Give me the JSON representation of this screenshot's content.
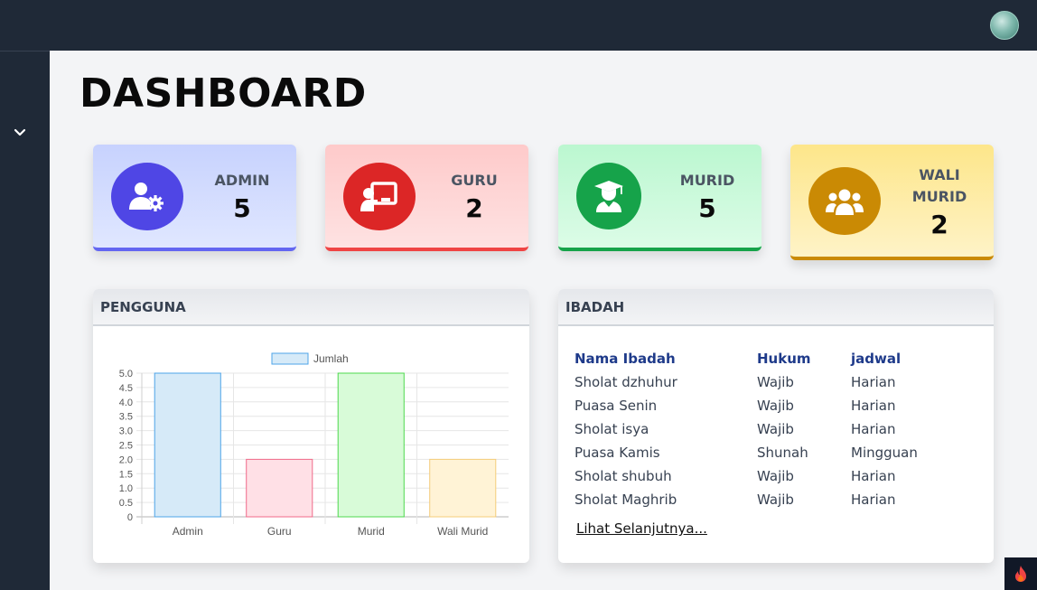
{
  "header": {
    "avatar_icon": "user-avatar"
  },
  "sidebar": {
    "toggle_icon": "chevron-down-icon"
  },
  "page": {
    "title": "DASHBOARD"
  },
  "cards": [
    {
      "label": "ADMIN",
      "count": "5",
      "icon": "user-gear-icon",
      "color": "#4f46e5"
    },
    {
      "label": "GURU",
      "count": "2",
      "icon": "chalkboard-teacher-icon",
      "color": "#dc2626"
    },
    {
      "label": "MURID",
      "count": "5",
      "icon": "graduate-icon",
      "color": "#16a34a"
    },
    {
      "label_line1": "WALI",
      "label_line2": "MURID",
      "count": "2",
      "icon": "users-icon",
      "color": "#ca8a04"
    }
  ],
  "pengguna": {
    "title": "PENGGUNA",
    "chart_data": {
      "type": "bar",
      "categories": [
        "Admin",
        "Guru",
        "Murid",
        "Wali Murid"
      ],
      "series": [
        {
          "name": "Jumlah",
          "values": [
            5,
            2,
            5,
            2
          ]
        }
      ],
      "colors": [
        "#d6eaf8",
        "#ffe0e6",
        "#d8fbd8",
        "#fff3d6"
      ],
      "borders": [
        "#4ea4e8",
        "#f06a8a",
        "#4ed84e",
        "#f4cc7a"
      ],
      "yticks": [
        "0",
        "0.5",
        "1.0",
        "1.5",
        "2.0",
        "2.5",
        "3.0",
        "3.5",
        "4.0",
        "4.5",
        "5.0"
      ],
      "ylim": [
        0,
        5
      ],
      "grid": true,
      "legend": "top"
    }
  },
  "ibadah": {
    "title": "IBADAH",
    "columns": [
      "Nama Ibadah",
      "Hukum",
      "jadwal"
    ],
    "rows": [
      [
        "Sholat dzhuhur",
        "Wajib",
        "Harian"
      ],
      [
        "Puasa Senin",
        "Wajib",
        "Harian"
      ],
      [
        "Sholat isya",
        "Wajib",
        "Harian"
      ],
      [
        "Puasa Kamis",
        "Shunah",
        "Mingguan"
      ],
      [
        "Sholat shubuh",
        "Wajib",
        "Harian"
      ],
      [
        "Sholat Maghrib",
        "Wajib",
        "Harian"
      ]
    ],
    "more_link": "Lihat Selanjutnya..."
  },
  "corner": {
    "icon": "flame-icon"
  }
}
